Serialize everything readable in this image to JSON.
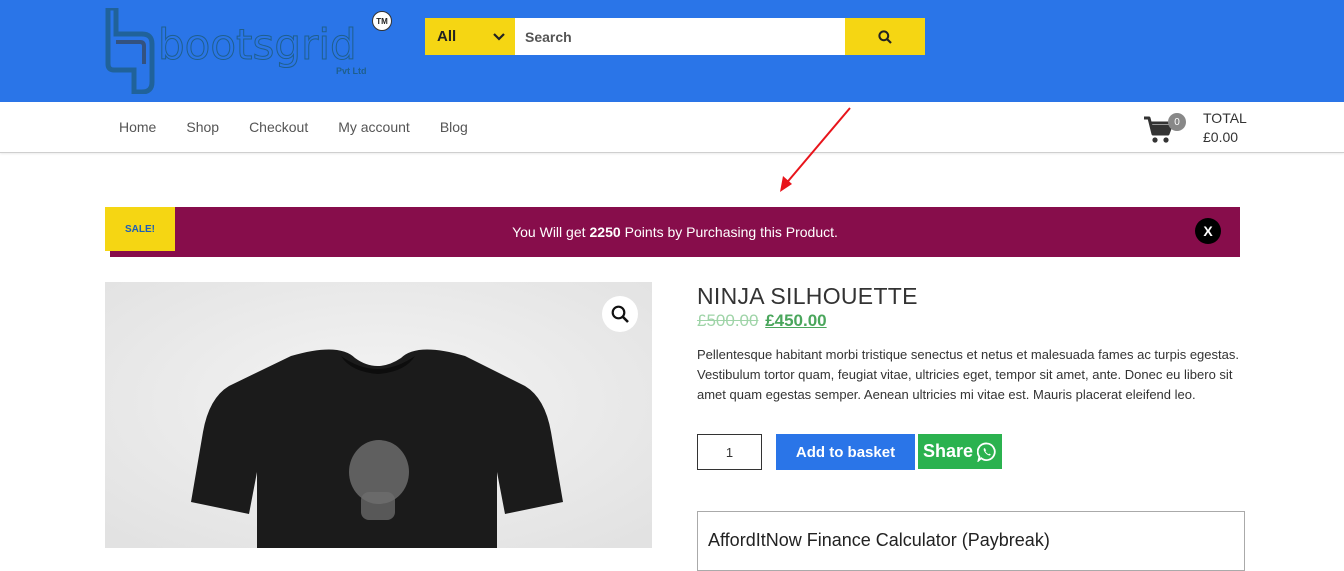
{
  "header": {
    "logo": {
      "text": "bootsgrid",
      "sub": "Pvt Ltd",
      "tm": "TM"
    },
    "search": {
      "category": "All",
      "placeholder": "Search"
    },
    "colors": {
      "bar": "#2a75e8",
      "accent": "#f5d613"
    }
  },
  "nav": {
    "items": [
      {
        "label": "Home"
      },
      {
        "label": "Shop"
      },
      {
        "label": "Checkout"
      },
      {
        "label": "My account"
      },
      {
        "label": "Blog"
      }
    ]
  },
  "cart": {
    "count": "0",
    "total_label": "TOTAL",
    "total_value": "£0.00"
  },
  "banner": {
    "sale": "SALE!",
    "text_before": "You Will get",
    "points": "2250",
    "text_after": "Points by Purchasing this Product.",
    "close": "X",
    "color": "#870d4b"
  },
  "product": {
    "title": "NINJA SILHOUETTE",
    "old_price": "£500.00",
    "new_price": "£450.00",
    "description": "Pellentesque habitant morbi tristique senectus et netus et malesuada fames ac turpis egestas. Vestibulum tortor quam, feugiat vitae, ultricies eget, tempor sit amet, ante. Donec eu libero sit amet quam egestas semper. Aenean ultricies mi vitae est. Mauris placerat eleifend leo.",
    "quantity": "1",
    "add_to_basket": "Add to basket",
    "share": "Share"
  },
  "calculator": {
    "title": "AffordItNow Finance Calculator (Paybreak)"
  },
  "icons": [
    "search-icon",
    "chevron-down-icon",
    "cart-icon",
    "zoom-icon",
    "whatsapp-icon",
    "close-icon"
  ]
}
